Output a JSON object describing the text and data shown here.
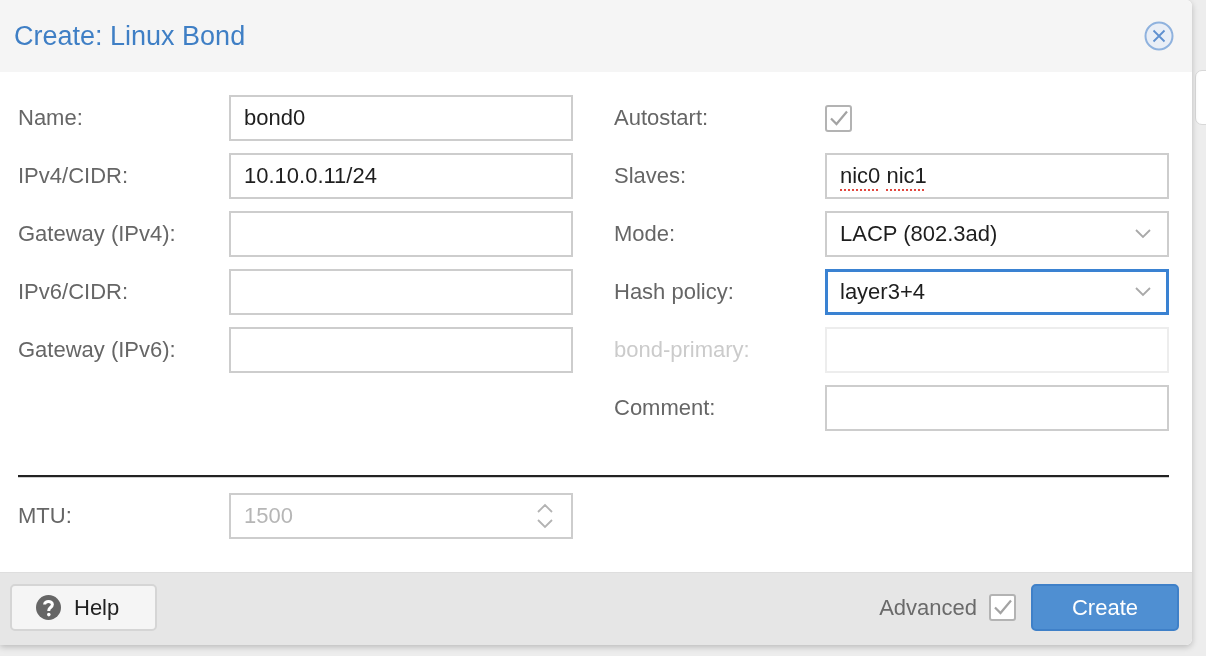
{
  "dialog": {
    "title": "Create: Linux Bond",
    "left_fields": [
      {
        "label": "Name:",
        "kind": "text",
        "value": "bond0",
        "spell_flagged": false,
        "disabled": false,
        "focused": false
      },
      {
        "label": "IPv4/CIDR:",
        "kind": "text",
        "value": "10.10.0.11/24",
        "spell_flagged": false,
        "disabled": false,
        "focused": false
      },
      {
        "label": "Gateway (IPv4):",
        "kind": "text",
        "disabled": false,
        "focused": false
      },
      {
        "label": "IPv6/CIDR:",
        "kind": "text",
        "disabled": false,
        "focused": false
      },
      {
        "label": "Gateway (IPv6):",
        "kind": "text",
        "disabled": false,
        "focused": false
      }
    ],
    "right_fields": [
      {
        "label": "Autostart:",
        "kind": "checkbox",
        "checked": true,
        "disabled": false
      },
      {
        "label": "Slaves:",
        "kind": "text",
        "value": "nic0 nic1",
        "spell_flagged": true,
        "disabled": false,
        "focused": false
      },
      {
        "label": "Mode:",
        "kind": "select",
        "value": "LACP (802.3ad)",
        "spell_flagged": false,
        "disabled": false,
        "focused": false
      },
      {
        "label": "Hash policy:",
        "kind": "select",
        "value": "layer3+4",
        "spell_flagged": false,
        "disabled": false,
        "focused": true
      },
      {
        "label": "bond-primary:",
        "kind": "text",
        "disabled": true,
        "focused": false
      },
      {
        "label": "Comment:",
        "kind": "text",
        "disabled": false,
        "focused": false
      }
    ],
    "advanced_fields": [
      {
        "label": "MTU:",
        "kind": "number",
        "placeholder": "1500",
        "disabled": false,
        "focused": false
      }
    ],
    "footer": {
      "help_button": "Help",
      "advanced": {
        "label": "Advanced",
        "checked": true
      },
      "create_button": "Create"
    }
  }
}
